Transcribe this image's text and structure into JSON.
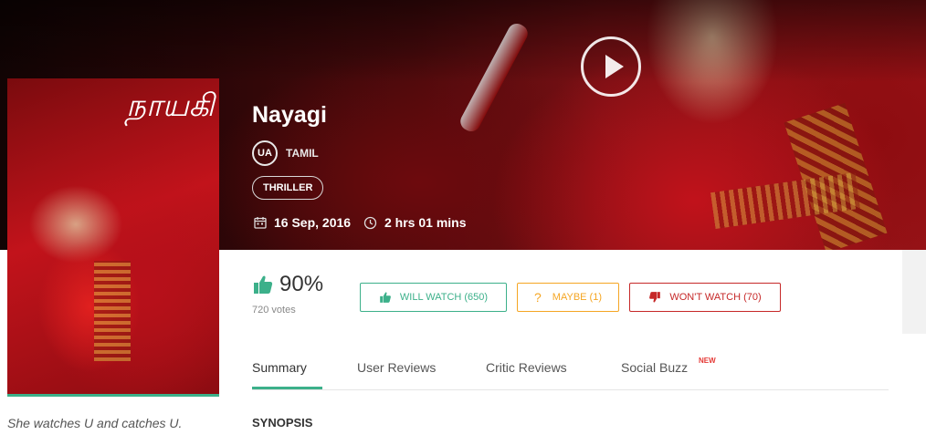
{
  "movie": {
    "title": "Nayagi",
    "certificate": "UA",
    "language": "TAMIL",
    "genre": "THRILLER",
    "release_date": "16 Sep, 2016",
    "duration": "2 hrs 01 mins",
    "tagline": "She watches U and catches U.",
    "poster_title": "நாயகி"
  },
  "rating": {
    "percent": "90%",
    "votes": "720 votes"
  },
  "actions": {
    "will_watch": "WILL WATCH (650)",
    "maybe_icon": "?",
    "maybe": "MAYBE (1)",
    "wont_watch": "WON'T WATCH (70)"
  },
  "tabs": {
    "items": [
      {
        "label": "Summary",
        "active": true
      },
      {
        "label": "User Reviews",
        "active": false
      },
      {
        "label": "Critic Reviews",
        "active": false
      },
      {
        "label": "Social Buzz",
        "active": false
      }
    ],
    "new_badge": "NEW"
  },
  "section": {
    "synopsis": "SYNOPSIS"
  },
  "icons": {
    "play": "play-icon",
    "calendar": "calendar-icon",
    "clock": "clock-icon",
    "rating": "thumbs-up-icon",
    "will_watch": "thumbs-up-icon",
    "maybe": "question-icon",
    "wont_watch": "thumbs-down-icon"
  },
  "colors": {
    "accent_green": "#3cb08a",
    "maybe_orange": "#f5a623",
    "wont_red": "#c62828",
    "new_badge": "#e53935"
  }
}
